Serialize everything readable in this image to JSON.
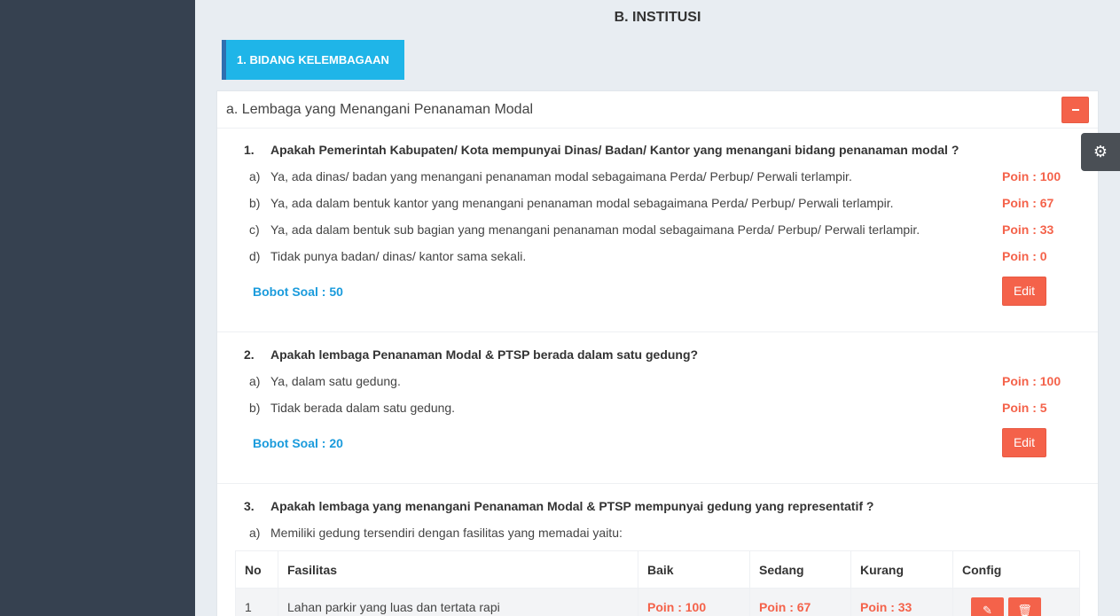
{
  "page_title": "B. INSTITUSI",
  "section_tag": "1. BIDANG KELEMBAGAAN",
  "panel": {
    "title": "a. Lembaga yang Menangani Penanaman Modal"
  },
  "questions": [
    {
      "num": "1.",
      "text": "Apakah Pemerintah Kabupaten/ Kota mempunyai Dinas/ Badan/ Kantor yang menangani bidang penanaman modal ?",
      "options": [
        {
          "letter": "a)",
          "text": "Ya, ada dinas/ badan yang menangani penanaman modal sebagaimana Perda/ Perbup/ Perwali terlampir.",
          "poin": "Poin : 100"
        },
        {
          "letter": "b)",
          "text": "Ya, ada dalam bentuk kantor yang menangani penanaman modal sebagaimana Perda/ Perbup/ Perwali terlampir.",
          "poin": "Poin : 67"
        },
        {
          "letter": "c)",
          "text": "Ya, ada dalam bentuk sub bagian yang menangani penanaman modal sebagaimana Perda/ Perbup/ Perwali terlampir.",
          "poin": "Poin : 33"
        },
        {
          "letter": "d)",
          "text": "Tidak punya badan/ dinas/ kantor sama sekali.",
          "poin": "Poin : 0"
        }
      ],
      "bobot": "Bobot Soal : 50",
      "edit_label": "Edit"
    },
    {
      "num": "2.",
      "text": "Apakah lembaga Penanaman Modal & PTSP berada dalam satu gedung?",
      "options": [
        {
          "letter": "a)",
          "text": "Ya, dalam satu gedung.",
          "poin": "Poin : 100"
        },
        {
          "letter": "b)",
          "text": "Tidak berada dalam satu gedung.",
          "poin": "Poin : 5"
        }
      ],
      "bobot": "Bobot Soal : 20",
      "edit_label": "Edit"
    },
    {
      "num": "3.",
      "text": "Apakah lembaga yang menangani Penanaman Modal & PTSP mempunyai gedung yang representatif ?",
      "options": [
        {
          "letter": "a)",
          "text": "Memiliki gedung tersendiri dengan fasilitas yang memadai yaitu:"
        }
      ]
    }
  ],
  "table": {
    "headers": [
      "No",
      "Fasilitas",
      "Baik",
      "Sedang",
      "Kurang",
      "Config"
    ],
    "rows": [
      {
        "no": "1",
        "fasilitas": "Lahan parkir yang luas dan tertata rapi",
        "baik": "Poin : 100",
        "sedang": "Poin : 67",
        "kurang": "Poin : 33"
      }
    ]
  },
  "icons": {
    "collapse": "minus-icon",
    "settings": "gear-icon",
    "edit": "pencil-icon",
    "delete": "trash-icon"
  },
  "colors": {
    "accent_red": "#f4624a",
    "accent_blue": "#1fb5e8",
    "bobot_blue": "#1a9bdc",
    "sidebar": "#364150"
  }
}
